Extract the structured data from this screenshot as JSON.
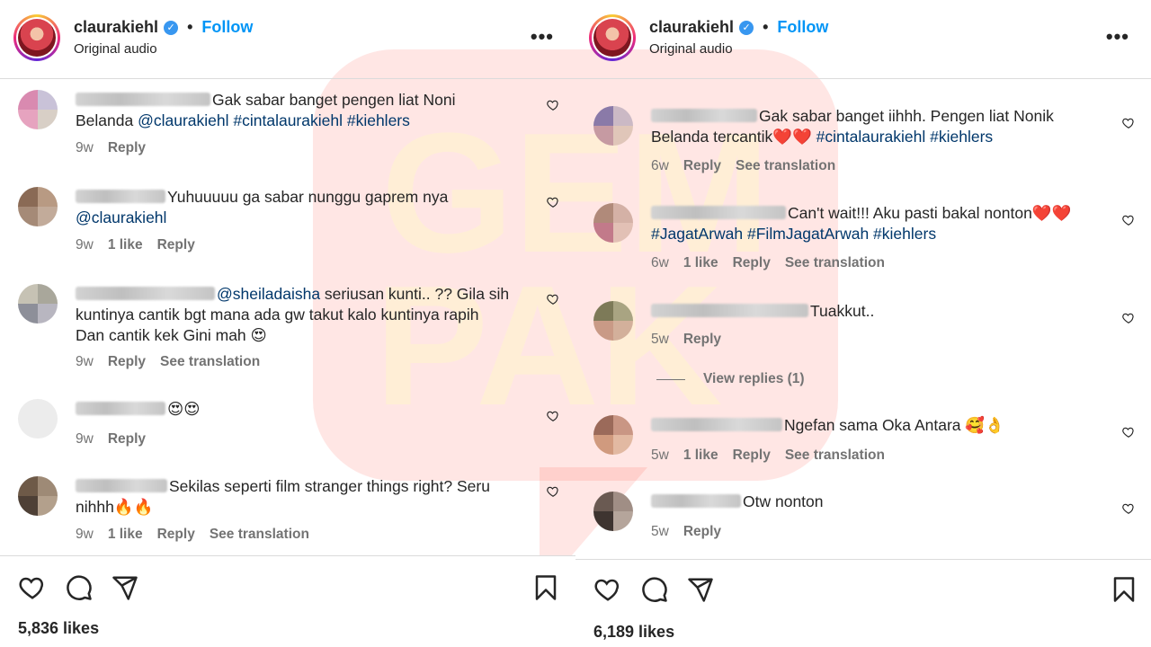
{
  "watermark": {
    "text": "GEMPAK"
  },
  "left": {
    "header": {
      "username": "claurakiehl",
      "separator": "•",
      "follow_label": "Follow",
      "subtitle": "Original audio",
      "more_label": "•••"
    },
    "comments": [
      {
        "text": "Gak sabar banget pengen liat Noni",
        "text2": "Belanda ",
        "mention": "@claurakiehl",
        "tags": " #cintalaurakiehl #kiehlers",
        "time": "9w",
        "likes": "",
        "reply": "Reply",
        "translate": ""
      },
      {
        "text": "Yuhuuuuu ga sabar nunggu gaprem nya",
        "mention": "@claurakiehl",
        "time": "9w",
        "likes": "1 like",
        "reply": "Reply",
        "translate": ""
      },
      {
        "mention": "@sheiladaisha",
        "text": " seriusan kunti.. ?? Gila sih",
        "text2": "kuntinya cantik bgt mana ada gw takut kalo kuntinya rapih",
        "text3": "Dan cantik kek Gini mah 😍",
        "time": "9w",
        "likes": "",
        "reply": "Reply",
        "translate": "See translation"
      },
      {
        "text": "😍😍",
        "time": "9w",
        "likes": "",
        "reply": "Reply",
        "translate": ""
      },
      {
        "text": "Sekilas seperti film stranger things right? Seru",
        "text2": "nihhh🔥🔥",
        "time": "9w",
        "likes": "1 like",
        "reply": "Reply",
        "translate": "See translation"
      }
    ],
    "likes_count": "5,836 likes"
  },
  "right": {
    "header": {
      "username": "claurakiehl",
      "separator": "•",
      "follow_label": "Follow",
      "subtitle": "Original audio",
      "more_label": "•••"
    },
    "comments": [
      {
        "text": "Gak sabar banget iihhh. Pengen liat Nonik",
        "text2": "Belanda tercantik❤️❤️ ",
        "tags": "#cintalaurakiehl #kiehlers",
        "time": "6w",
        "likes": "",
        "reply": "Reply",
        "translate": "See translation"
      },
      {
        "text": "Can't wait!!! Aku pasti bakal nonton❤️❤️",
        "tags": "#JagatArwah #FilmJagatArwah #kiehlers",
        "time": "6w",
        "likes": "1 like",
        "reply": "Reply",
        "translate": "See translation"
      },
      {
        "text": "Tuakkut..",
        "time": "5w",
        "likes": "",
        "reply": "Reply",
        "translate": ""
      },
      {
        "text": "Ngefan sama Oka Antara 🥰👌",
        "time": "5w",
        "likes": "1 like",
        "reply": "Reply",
        "translate": "See translation"
      },
      {
        "text": "Otw nonton",
        "time": "5w",
        "likes": "",
        "reply": "Reply",
        "translate": ""
      }
    ],
    "view_replies": "View replies (1)",
    "likes_count": "6,189 likes"
  },
  "colors": {
    "accent": "#0095f6",
    "hashtag": "#00376b",
    "muted": "#737373",
    "text": "#262626",
    "watermark": "#ff3b30"
  },
  "icons": [
    "heart-icon",
    "comment-icon",
    "share-icon",
    "bookmark-icon",
    "more-icon",
    "verified-icon"
  ]
}
